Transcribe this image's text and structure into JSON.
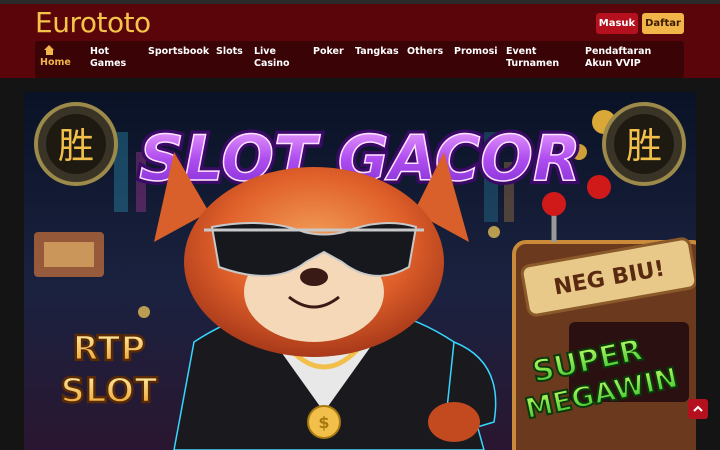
{
  "header": {
    "logo": "Eurototo",
    "login_label": "Masuk",
    "register_label": "Daftar"
  },
  "nav": {
    "items": [
      {
        "label": "Home",
        "icon": "home-icon",
        "active": true
      },
      {
        "label": "Hot Games"
      },
      {
        "label": "Sportsbook"
      },
      {
        "label": "Slots"
      },
      {
        "label": "Live Casino"
      },
      {
        "label": "Poker"
      },
      {
        "label": "Tangkas"
      },
      {
        "label": "Others"
      },
      {
        "label": "Promosi"
      },
      {
        "label": "Event Turnamen"
      },
      {
        "label": "Pendaftaran Akun VVIP"
      }
    ]
  },
  "banner": {
    "title": "SLOT GACOR",
    "left_badge": "RTP SLOT",
    "right_badge_line1": "SUPER",
    "right_badge_line2": "MEGAWIN",
    "machine_sign": "NEG BIU!",
    "emblem_glyph": "胜"
  },
  "colors": {
    "header_bg": "#5a0509",
    "nav_bg": "#3a0306",
    "accent_gold": "#f2b54a",
    "accent_red": "#b5101e"
  },
  "scroll_top_icon": "chevron-up-icon"
}
